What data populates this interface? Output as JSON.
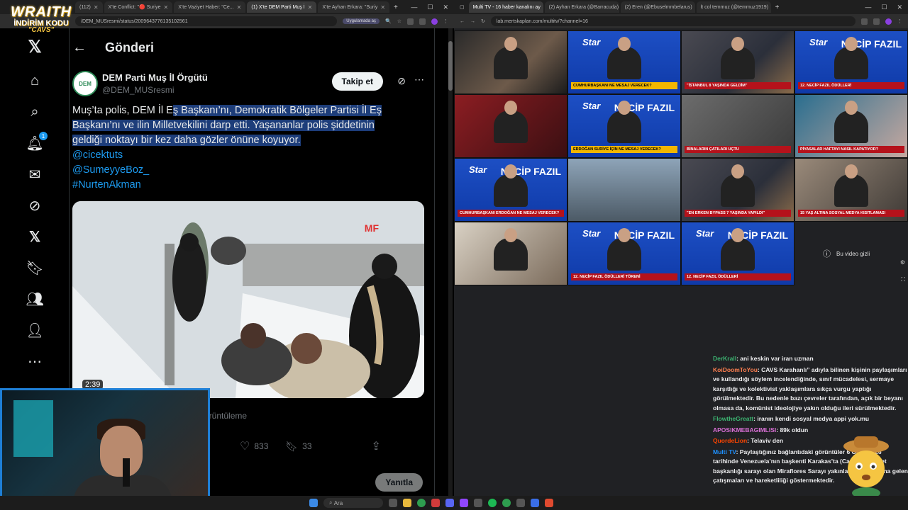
{
  "left_browser": {
    "tabs": [
      {
        "label": "(112)"
      },
      {
        "label": "X'te Conflict: \"🔴 Suriye"
      },
      {
        "label": "X'te Vaziyet Haber: \"Ce..."
      },
      {
        "label": "(1) X'te DEM Parti Muş İ"
      },
      {
        "label": "X'te Ayhan Erkara: \"Suriy"
      }
    ],
    "url": "/DEM_MUSresmi/status/2009643776135102561",
    "translate_pill": "Uygulamada aç"
  },
  "brand": {
    "title": "WRAITH",
    "discount_label": "İNDİRİM KODU",
    "code": "\"CAVS\""
  },
  "twitter": {
    "nav_badge": "1",
    "header_title": "Gönderi",
    "author_name": "DEM Parti Muş İl Örgütü",
    "author_handle": "@DEM_MUSresmi",
    "follow_label": "Takip et",
    "tweet_text_pre": "Muş’ta polis, DEM İl E",
    "tweet_text_hl": "ş Başkanı’nı, Demokratik Bölgeler Partisi İl Eş Başkanı’nı ve ilin Milletvekilini darp etti. Yaşananlar polis şiddetinin geldiği noktayı bir kez daha gözler önüne koyuyor.",
    "links": [
      "@cicektuts",
      "@SumeyyeBoz_",
      "#NurtenAkman"
    ],
    "media_watermark": "MF",
    "duration": "2:39",
    "views_label": "örüntüleme",
    "likes": "833",
    "bookmarks": "33",
    "reply_label": "Yanıtla"
  },
  "right_browser": {
    "tabs": [
      {
        "label": "Multi TV - 16 haber kanalını ay"
      },
      {
        "label": "(2) Ayhan Erkara (@Barracuda)"
      },
      {
        "label": "(2) Eren (@Ebuselmmbelarus)"
      },
      {
        "label": "lt col temmuz (@temmuz1919)"
      }
    ],
    "url": "lab.mertskaplan.com/multitv/?channel=16",
    "hidden_video_label": "Bu video gizli"
  },
  "tiles": [
    {
      "style": "dark",
      "cap": ""
    },
    {
      "style": "blue",
      "logo": "Star",
      "cap": "CUMHURBAŞKANI NE MESAJ VERECEK?",
      "y": true
    },
    {
      "style": "studio",
      "cap": "\"İSTANBUL 8 YAŞINDA GELDİM\""
    },
    {
      "style": "blue",
      "logo": "Star",
      "big": "NECİP FAZIL",
      "cap": "12. NECİP FAZIL ÖDÜLLERİ"
    },
    {
      "style": "anchor",
      "cap": ""
    },
    {
      "style": "blue",
      "logo": "Star",
      "big": "NECİP FAZIL",
      "cap": "ERDOĞAN SURİYE İÇİN NE MESAJ VERECEK?",
      "y": true
    },
    {
      "style": "street",
      "cap": "BİNALARIN ÇATILARI UÇTU"
    },
    {
      "style": "borsa",
      "cap": "PİYASALAR HAFTAYI NASIL KAPATIYOR?"
    },
    {
      "style": "blue",
      "logo": "Star",
      "big": "NECİP FAZIL",
      "cap": "CUMHURBAŞKANI ERDOĞAN NE MESAJ VERECEK?"
    },
    {
      "style": "sky",
      "cap": ""
    },
    {
      "style": "studio",
      "cap": "\"EN ERKEN BYPASS 7 YAŞINDA YAPILDI\""
    },
    {
      "style": "street2",
      "cap": "15 YAŞ ALTINA SOSYAL MEDYA KISITLAMASI"
    },
    {
      "style": "office",
      "cap": ""
    },
    {
      "style": "blue",
      "logo": "Star",
      "big": "NECİP FAZIL",
      "cap": "12. NECİP FAZIL ÖDÜLLERİ TÖRENİ"
    },
    {
      "style": "blue",
      "logo": "Star",
      "big": "NECİP FAZIL",
      "cap": "12. NECİP FAZIL ÖDÜLLERİ"
    }
  ],
  "chat": [
    {
      "user": "DerKrall",
      "text": ": ani keskin var iran uzman",
      "cls": "u2"
    },
    {
      "user": "KoiDoomToYou",
      "text": ": CAVS Karahanlı” adıyla bilinen kişinin paylaşımları ve kullandığı söylem incelendiğinde, sınıf mücadelesi, sermaye karşıtlığı ve kolektivist yaklaşımlara sıkça vurgu yaptığı görülmektedir. Bu nedenle bazı çevreler tarafından, açık bir beyanı olmasa da, komünist ideolojiye yakın olduğu ileri sürülmektedir.",
      "cls": "u1"
    },
    {
      "user": "FlowtheGreatt",
      "text": ": iranın kendi sosyal medya appi yok.mu",
      "cls": "u2"
    },
    {
      "user": "APOSIKMEBAGIMLISI",
      "text": ": 89k oldun",
      "cls": "u3"
    },
    {
      "user": "QuordeLion",
      "text": ": Telaviv den",
      "cls": "u4"
    },
    {
      "user": "Multi TV",
      "text": ": Paylaştığınız bağlantıdaki görüntüler 6 Ocak 2026 tarihinde Venezuela’nın başkenti Karakas’ta (Caracas) devlet başkanlığı sarayı olan Miraflores Sarayı yakınlarında meydana gelen çatışmaları ve hareketliliği göstermektedir.",
      "cls": "u5"
    }
  ],
  "taskbar": {
    "search_placeholder": "Ara"
  }
}
